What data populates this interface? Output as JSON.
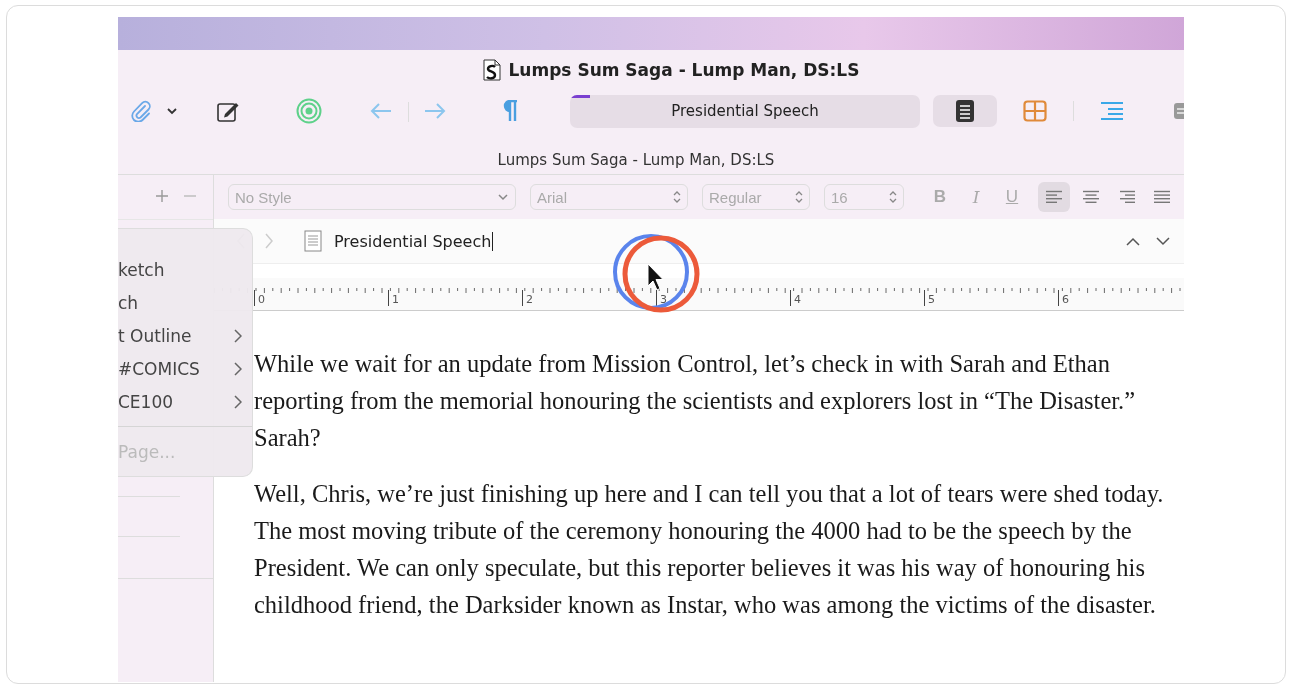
{
  "window": {
    "title": "Lumps Sum Saga - Lump Man, DS:LS"
  },
  "toolbar": {
    "title_field": "Presidential Speech",
    "views": [
      {
        "kind": "document",
        "selected": true
      },
      {
        "kind": "corkboard",
        "selected": false
      },
      {
        "kind": "outline",
        "selected": false
      }
    ]
  },
  "subtitle": "Lumps Sum Saga - Lump Man, DS:LS",
  "format_bar": {
    "style": "No Style",
    "font": "Arial",
    "weight": "Regular",
    "size": "16",
    "text_styles": [
      {
        "kind": "bold",
        "label": "B"
      },
      {
        "kind": "italic",
        "label": "I"
      },
      {
        "kind": "underline",
        "label": "U"
      }
    ],
    "alignments": [
      {
        "kind": "left",
        "selected": true
      },
      {
        "kind": "center",
        "selected": false
      },
      {
        "kind": "right",
        "selected": false
      },
      {
        "kind": "justify",
        "selected": false
      }
    ]
  },
  "header": {
    "title": "Presidential Speech"
  },
  "ruler": {
    "marks": [
      "0",
      "1",
      "2",
      "3",
      "4",
      "5",
      "6"
    ]
  },
  "menu": {
    "items": [
      {
        "kind": "item",
        "label": "ketch",
        "submenu": false,
        "disabled": false
      },
      {
        "kind": "item",
        "label": "ch",
        "submenu": false,
        "disabled": false
      },
      {
        "kind": "item",
        "label": "t Outline",
        "submenu": true,
        "disabled": false
      },
      {
        "kind": "item",
        "label": "#COMICS",
        "submenu": true,
        "disabled": false
      },
      {
        "kind": "item",
        "label": "CE100",
        "submenu": true,
        "disabled": false
      },
      {
        "kind": "separator"
      },
      {
        "kind": "item",
        "label": "Page...",
        "submenu": false,
        "disabled": true
      }
    ]
  },
  "paragraphs": [
    "While we wait for an update from Mission Control, let’s check in with Sarah and Ethan reporting from the memorial honouring the scientists and explorers lost in “The Disaster.” Sarah?",
    "Well, Chris, we’re just finishing up here and I can tell you that a lot of tears were shed today. The most moving tribute of the ceremony honouring the 4000 had to be the speech by the President. We can only speculate, but this reporter believes it was his way of honouring his childhood friend, the Darksider known as Instar, who was among the victims of the disaster."
  ]
}
